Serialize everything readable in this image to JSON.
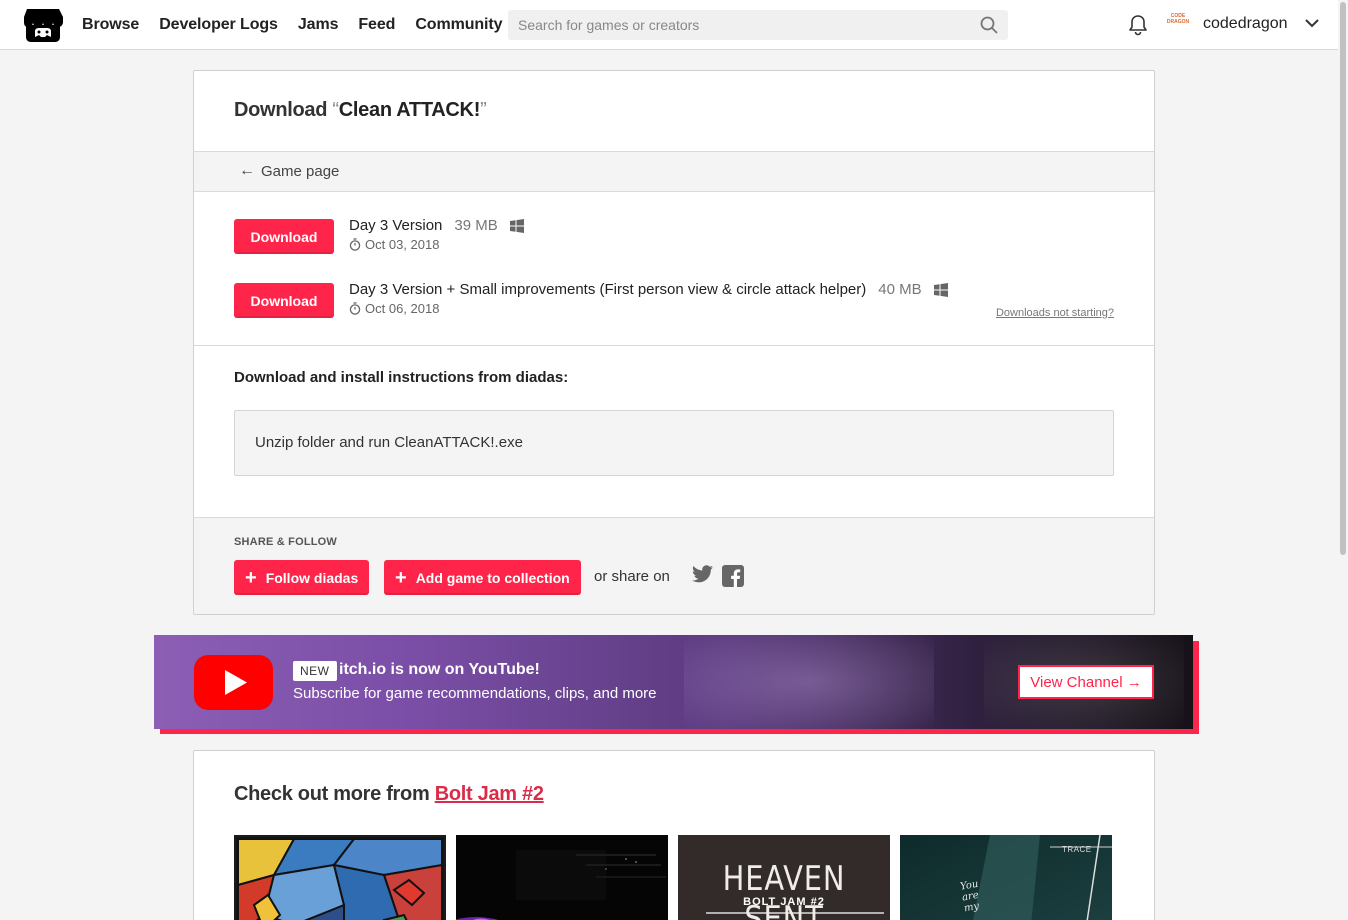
{
  "header": {
    "nav": [
      "Browse",
      "Developer Logs",
      "Jams",
      "Feed",
      "Community"
    ],
    "search_placeholder": "Search for games or creators",
    "avatar_text": "CODE DRAGON",
    "username": "codedragon"
  },
  "page": {
    "title_lead": "Download ",
    "title_open_quote": "“",
    "title_game": "Clean ATTACK!",
    "title_close_quote": "”",
    "back_link": "Game page"
  },
  "uploads": [
    {
      "button": "Download",
      "name": "Day 3 Version",
      "size": "39 MB",
      "platform": "windows-icon",
      "date": "Oct 03, 2018"
    },
    {
      "button": "Download",
      "name": "Day 3 Version + Small improvements (First person view & circle attack helper)",
      "size": "40 MB",
      "platform": "windows-icon",
      "date": "Oct 06, 2018"
    }
  ],
  "downloads_not_starting": "Downloads not starting?",
  "instructions": {
    "heading": "Download and install instructions from diadas:",
    "text": "Unzip folder and run CleanATTACK!.exe"
  },
  "share": {
    "label": "SHARE & FOLLOW",
    "follow_button": "Follow diadas",
    "collection_button": "Add game to collection",
    "or_share": "or share on"
  },
  "youtube_banner": {
    "badge": "NEW",
    "title": "itch.io is now on YouTube!",
    "subtitle": "Subscribe for game recommendations, clips, and more",
    "button": "View Channel →"
  },
  "more": {
    "prefix": "Check out more from ",
    "link": "Bolt Jam #2",
    "thumb3_title": "HEAVEN SENT",
    "thumb3_sub": "BOLT JAM #2",
    "thumb4_text_a": "TRACE",
    "thumb4_text_b": "You are my"
  },
  "colors": {
    "accent": "#ff2449",
    "link": "#da2c49",
    "background": "#f4f4f4"
  }
}
